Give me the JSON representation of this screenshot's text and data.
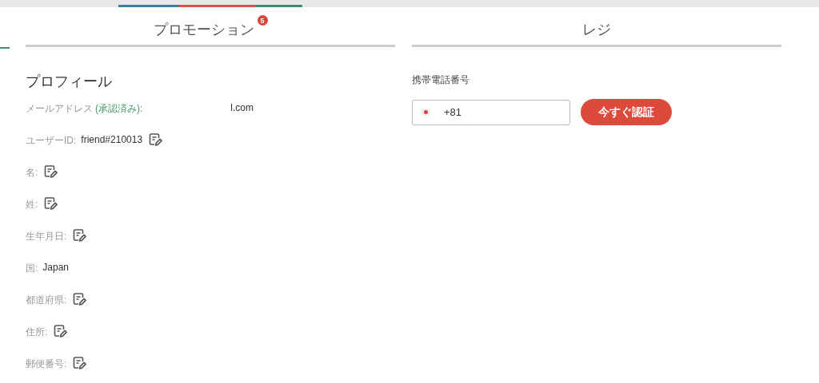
{
  "top_nav": {
    "segments": [
      {
        "color": "#3d7f9a"
      },
      {
        "color": "#d9534f"
      },
      {
        "color": "#3a8f6e"
      }
    ]
  },
  "sections": [
    {
      "title": "プロモーション",
      "badge": "5"
    },
    {
      "title": "レジ"
    }
  ],
  "profile": {
    "title": "プロフィール",
    "fields": [
      {
        "label": "メールアドレス",
        "note": "(承認済み):",
        "value": "l.com",
        "editable": false
      },
      {
        "label": "ユーザーID:",
        "value": "friend#210013",
        "editable": true
      },
      {
        "label": "名:",
        "editable": true
      },
      {
        "label": "姓:",
        "editable": true
      },
      {
        "label": "生年月日:",
        "editable": true
      },
      {
        "label": "国:",
        "value": "Japan",
        "editable": false
      },
      {
        "label": "都道府県:",
        "editable": true
      },
      {
        "label": "住所:",
        "editable": true
      },
      {
        "label": "郵便番号:",
        "editable": true
      }
    ]
  },
  "phone": {
    "label": "携帯電話番号",
    "code": "+81",
    "button": "今すぐ認証"
  }
}
